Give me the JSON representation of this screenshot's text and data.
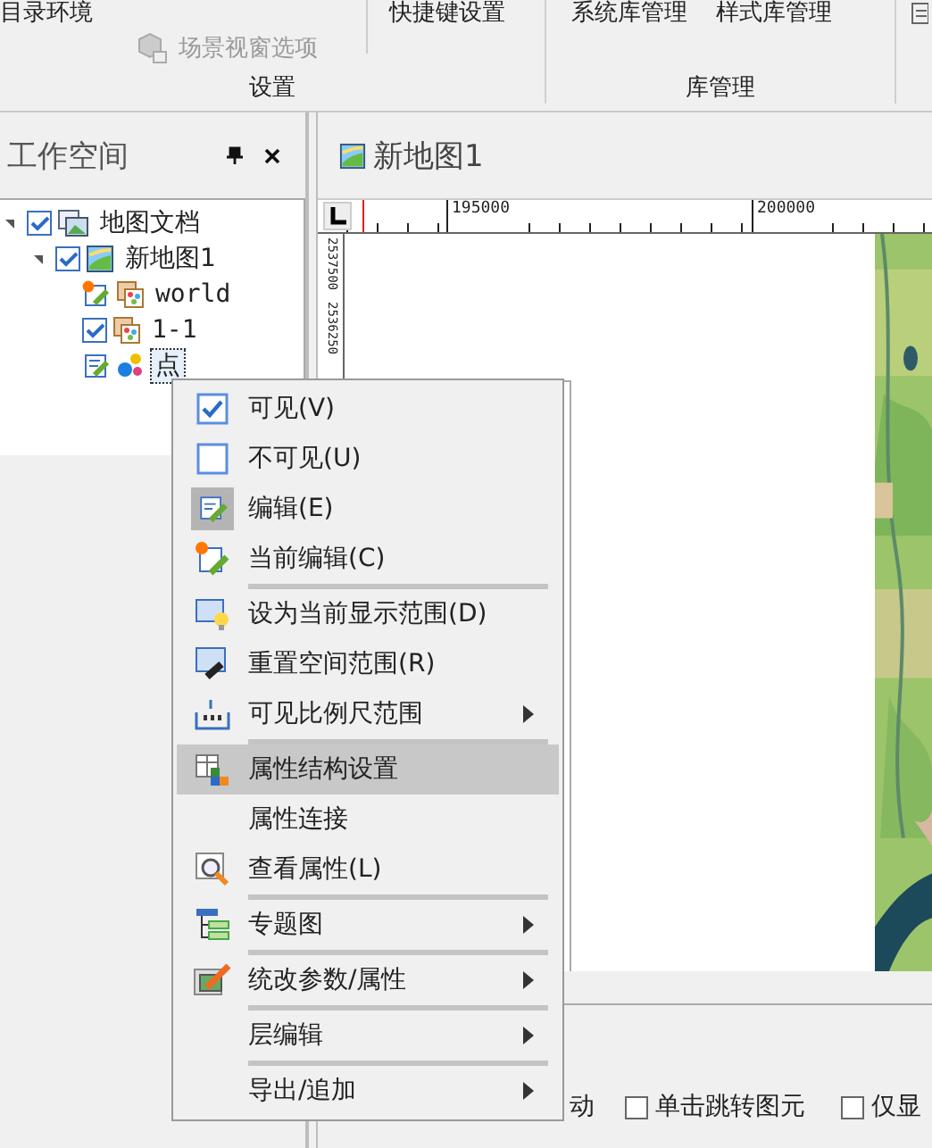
{
  "ribbon": {
    "groups": [
      {
        "label": "设置",
        "buttons": [
          {
            "label": "目录环境",
            "disabled": false
          },
          {
            "label": "场景视窗选项",
            "disabled": true
          },
          {
            "label": "快捷键设置",
            "disabled": false
          }
        ]
      },
      {
        "label": "库管理",
        "buttons": [
          {
            "label": "系统库管理",
            "disabled": false
          },
          {
            "label": "样式库管理",
            "disabled": false
          }
        ]
      }
    ]
  },
  "workspace": {
    "title": "工作空间",
    "tree": [
      {
        "label": "地图文档",
        "checked": true,
        "expanded": true,
        "selected": false,
        "children": [
          {
            "label": "新地图1",
            "checked": true,
            "expanded": true,
            "selected": false,
            "children": [
              {
                "label": "world",
                "kind": "region",
                "editable": true,
                "current_edit": true,
                "selected": false
              },
              {
                "label": "1-1",
                "kind": "region",
                "editable": false,
                "checked": true,
                "selected": false
              },
              {
                "label": "点",
                "kind": "point",
                "editable": true,
                "current_edit": false,
                "selected": true
              }
            ]
          }
        ]
      }
    ]
  },
  "map_tab": {
    "title": "新地图1"
  },
  "rulers": {
    "horizontal": [
      "195000",
      "200000"
    ],
    "vertical": [
      "2537500",
      "2536250"
    ]
  },
  "context_menu": [
    {
      "label": "可见(V)",
      "kind": "check",
      "checked": true,
      "icon_active": false,
      "submenu": false,
      "selected": false,
      "separator_after": false
    },
    {
      "label": "不可见(U)",
      "kind": "check",
      "checked": false,
      "icon_active": false,
      "submenu": false,
      "selected": false,
      "separator_after": false
    },
    {
      "label": "编辑(E)",
      "kind": "edit",
      "icon_active": true,
      "submenu": false,
      "selected": false,
      "separator_after": false
    },
    {
      "label": "当前编辑(C)",
      "kind": "current-edit",
      "icon_active": false,
      "submenu": false,
      "selected": false,
      "separator_after": true
    },
    {
      "label": "设为当前显示范围(D)",
      "kind": "bulb",
      "icon_active": false,
      "submenu": false,
      "selected": false,
      "separator_after": false
    },
    {
      "label": "重置空间范围(R)",
      "kind": "eraser",
      "icon_active": false,
      "submenu": false,
      "selected": false,
      "separator_after": false
    },
    {
      "label": "可见比例尺范围",
      "kind": "scale",
      "icon_active": false,
      "submenu": true,
      "selected": false,
      "separator_after": true
    },
    {
      "label": "属性结构设置",
      "kind": "table",
      "icon_active": false,
      "submenu": false,
      "selected": true,
      "separator_after": false
    },
    {
      "label": "属性连接",
      "kind": "plain",
      "icon_active": false,
      "submenu": false,
      "selected": false,
      "separator_after": false
    },
    {
      "label": "查看属性(L)",
      "kind": "magnifier",
      "icon_active": false,
      "submenu": false,
      "selected": false,
      "separator_after": true
    },
    {
      "label": "专题图",
      "kind": "theme",
      "icon_active": false,
      "submenu": true,
      "selected": false,
      "separator_after": true
    },
    {
      "label": "统改参数/属性",
      "kind": "pencil",
      "icon_active": false,
      "submenu": true,
      "selected": false,
      "separator_after": true
    },
    {
      "label": "层编辑",
      "kind": "plain",
      "icon_active": false,
      "submenu": true,
      "selected": false,
      "separator_after": true
    },
    {
      "label": "导出/追加",
      "kind": "plain",
      "icon_active": false,
      "submenu": true,
      "selected": false,
      "separator_after": false
    }
  ],
  "bottom_panel": {
    "fragment": "动",
    "options": [
      {
        "label": "单击跳转图元",
        "checked": false
      },
      {
        "label": "仅显",
        "checked": false
      }
    ]
  }
}
